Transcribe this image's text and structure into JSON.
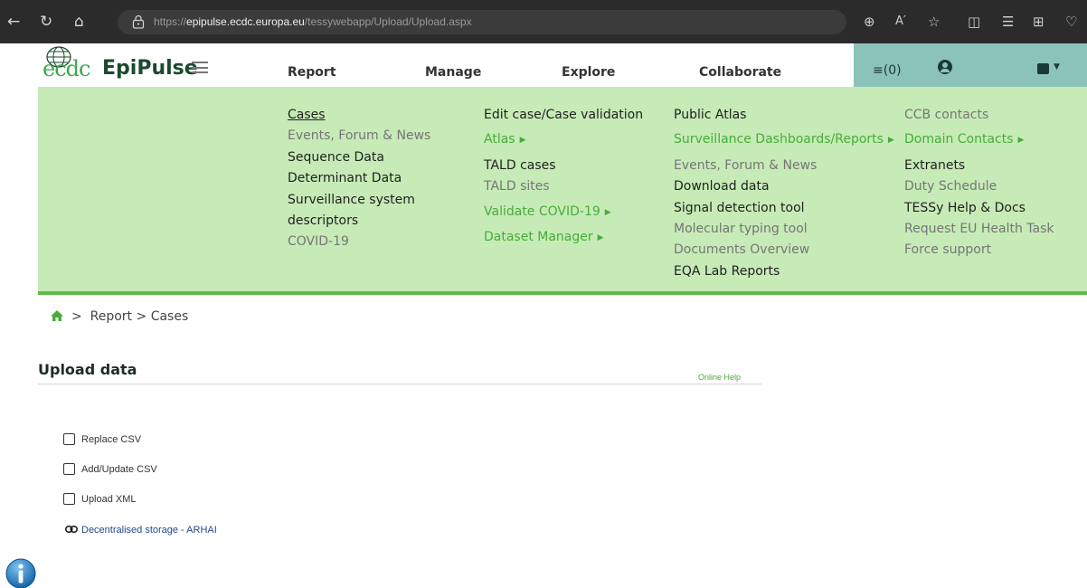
{
  "browser": {
    "url_prefix": "https://",
    "url_host": "epipulse.ecdc.europa.eu",
    "url_path": "/tessywebapp/Upload/Upload.aspx"
  },
  "header": {
    "logo_ecdc": "ecdc",
    "logo_name": "EpiPulse",
    "nav": [
      "Report",
      "Manage",
      "Explore",
      "Collaborate"
    ],
    "task_count": "(0)"
  },
  "mega_menu": {
    "report": [
      "Cases",
      "Events, Forum & News",
      "Sequence Data",
      "Determinant Data",
      "Surveillance system",
      "descriptors",
      "COVID-19"
    ],
    "manage": [
      "Edit case/Case validation",
      "Atlas",
      "TALD cases",
      "TALD sites",
      "Validate COVID-19",
      "Dataset Manager"
    ],
    "explore": [
      "Public Atlas",
      "Surveillance Dashboards/Reports",
      "Events, Forum & News",
      "Download data",
      "Signal detection tool",
      "Molecular typing tool",
      "Documents Overview",
      "EQA Lab Reports"
    ],
    "collaborate": [
      "CCB contacts",
      "Domain Contacts",
      "Extranets",
      "Duty Schedule",
      "TESSy Help & Docs",
      "Request EU Health Task",
      "Force support"
    ]
  },
  "breadcrumb": {
    "report": "Report",
    "cases": "Cases"
  },
  "upload": {
    "title": "Upload data",
    "online_help": "Online Help",
    "options": [
      "Replace CSV",
      "Add/Update CSV",
      "Upload XML"
    ],
    "storage_link": "Decentralised storage - ARHAI"
  },
  "colors": {
    "menu_bg": "#c7ebb7",
    "accent_green": "#46ad3a",
    "header_teal": "#8cc3b8"
  }
}
